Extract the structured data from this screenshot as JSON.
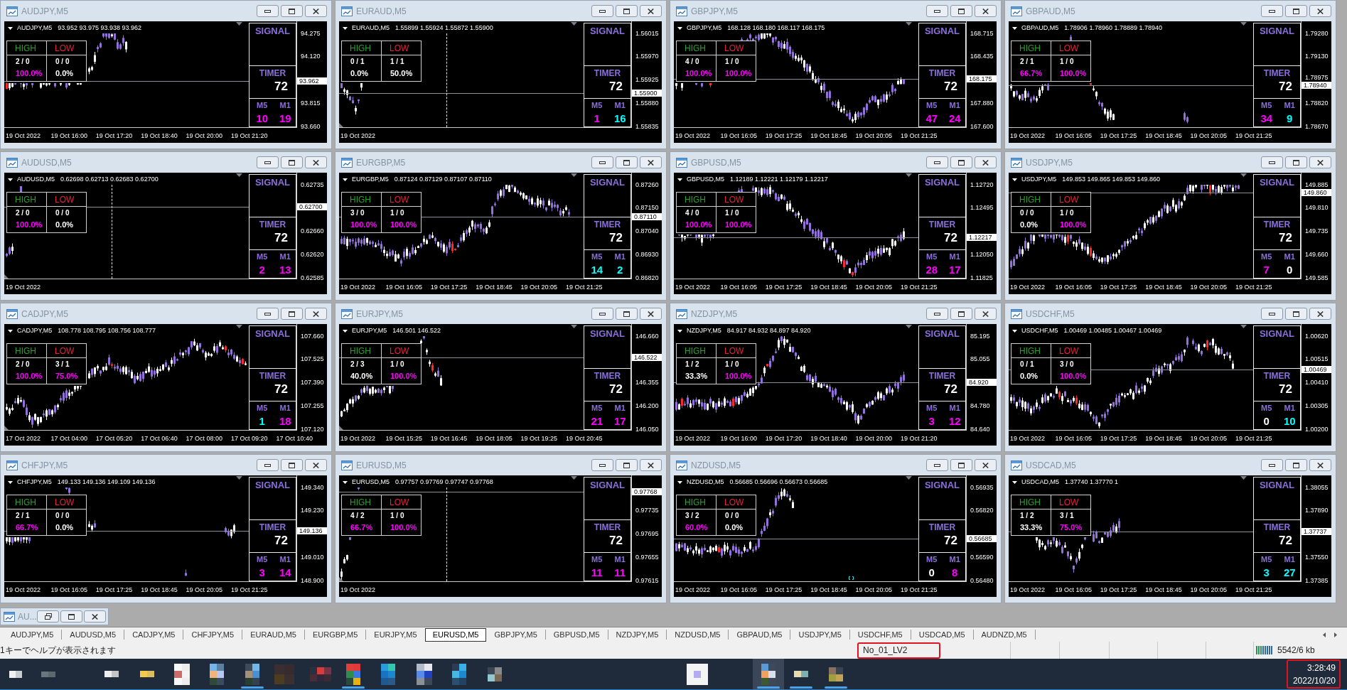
{
  "windows": [
    {
      "title": "AUDJPY,M5",
      "symbol": "AUDJPY,M5",
      "ohlc": "93.952 93.975 93.938 93.962",
      "price_labels": [
        "94.275",
        "94.120",
        "93.815",
        "93.660"
      ],
      "current_price": "93.962",
      "time_labels": [
        "19 Oct 2022",
        "19 Oct 16:00",
        "19 Oct 17:20",
        "19 Oct 18:40",
        "19 Oct 20:00",
        "19 Oct 21:20"
      ],
      "stats": [
        {
          "kind": "high",
          "label": "HIGH",
          "count": "2 / 0",
          "percent": "100.0%",
          "color": "#ff00ff"
        },
        {
          "kind": "low",
          "label": "LOW",
          "count": "0 / 0",
          "percent": "0.0%",
          "color": "#ffffff"
        }
      ],
      "signal": "SIGNAL",
      "timer": {
        "label": "TIMER",
        "value": "72"
      },
      "counters": [
        {
          "label": "M5",
          "value": "10",
          "color": "#ff00ff"
        },
        {
          "label": "M1",
          "value": "19",
          "color": "#ff00ff"
        }
      ]
    },
    {
      "title": "EURAUD,M5",
      "symbol": "EURAUD,M5",
      "ohlc": "1.55899 1.55924 1.55872 1.55900",
      "price_labels": [
        "1.56015",
        "1.55970",
        "1.55925",
        "1.55880",
        "1.55835"
      ],
      "current_price": "1.55900",
      "time_labels": [
        "19 Oct 2022"
      ],
      "separator_line": true,
      "stats": [
        {
          "kind": "high",
          "label": "HIGH",
          "count": "0 / 1",
          "percent": "0.0%",
          "color": "#ffffff"
        },
        {
          "kind": "low",
          "label": "LOW",
          "count": "1 / 1",
          "percent": "50.0%",
          "color": "#ffffff"
        }
      ],
      "signal": "SIGNAL",
      "timer": {
        "label": "TIMER",
        "value": "72"
      },
      "counters": [
        {
          "label": "M5",
          "value": "1",
          "color": "#ff00ff"
        },
        {
          "label": "M1",
          "value": "16",
          "color": "#00ffff"
        }
      ]
    },
    {
      "title": "GBPJPY,M5",
      "symbol": "GBPJPY,M5",
      "ohlc": "168.128 168.180 168.117 168.175",
      "price_labels": [
        "168.715",
        "168.435",
        "167.880",
        "167.600"
      ],
      "current_price": "168.175",
      "time_labels": [
        "19 Oct 2022",
        "19 Oct 16:05",
        "19 Oct 17:25",
        "19 Oct 18:45",
        "19 Oct 20:05",
        "19 Oct 21:25"
      ],
      "stats": [
        {
          "kind": "high",
          "label": "HIGH",
          "count": "4 / 0",
          "percent": "100.0%",
          "color": "#ff00ff"
        },
        {
          "kind": "low",
          "label": "LOW",
          "count": "1 / 0",
          "percent": "100.0%",
          "color": "#ff00ff"
        }
      ],
      "signal": "SIGNAL",
      "timer": {
        "label": "TIMER",
        "value": "72"
      },
      "counters": [
        {
          "label": "M5",
          "value": "47",
          "color": "#ff00ff"
        },
        {
          "label": "M1",
          "value": "24",
          "color": "#ff00ff"
        }
      ]
    },
    {
      "title": "GBPAUD,M5",
      "symbol": "GBPAUD,M5",
      "ohlc": "1.78906 1.78960 1.78889 1.78940",
      "price_labels": [
        "1.79280",
        "1.79130",
        "1.78975",
        "1.78820",
        "1.78670"
      ],
      "current_price": "1.78940",
      "time_labels": [
        "19 Oct 2022",
        "19 Oct 16:05",
        "19 Oct 17:25",
        "19 Oct 18:45",
        "19 Oct 20:05",
        "19 Oct 21:25"
      ],
      "stats": [
        {
          "kind": "high",
          "label": "HIGH",
          "count": "2 / 1",
          "percent": "66.7%",
          "color": "#ff00ff"
        },
        {
          "kind": "low",
          "label": "LOW",
          "count": "1 / 0",
          "percent": "100.0%",
          "color": "#ff00ff"
        }
      ],
      "signal": "SIGNAL",
      "timer": {
        "label": "TIMER",
        "value": "72"
      },
      "counters": [
        {
          "label": "M5",
          "value": "34",
          "color": "#ff00ff"
        },
        {
          "label": "M1",
          "value": "9",
          "color": "#00ffff"
        }
      ]
    },
    {
      "title": "AUDUSD,M5",
      "symbol": "AUDUSD,M5",
      "ohlc": "0.62698 0.62713 0.62683 0.62700",
      "price_labels": [
        "0.62735",
        "0.62660",
        "0.62620",
        "0.62585"
      ],
      "current_price": "0.62700",
      "time_labels": [
        "19 Oct 2022"
      ],
      "separator_line": true,
      "stats": [
        {
          "kind": "high",
          "label": "HIGH",
          "count": "2 / 0",
          "percent": "100.0%",
          "color": "#ff00ff"
        },
        {
          "kind": "low",
          "label": "LOW",
          "count": "0 / 0",
          "percent": "0.0%",
          "color": "#ffffff"
        }
      ],
      "signal": "SIGNAL",
      "timer": {
        "label": "TIMER",
        "value": "72"
      },
      "counters": [
        {
          "label": "M5",
          "value": "2",
          "color": "#ff00ff"
        },
        {
          "label": "M1",
          "value": "13",
          "color": "#ff00ff"
        }
      ]
    },
    {
      "title": "EURGBP,M5",
      "symbol": "EURGBP,M5",
      "ohlc": "0.87124 0.87129 0.87107 0.87110",
      "price_labels": [
        "0.87260",
        "0.87150",
        "0.87040",
        "0.86930",
        "0.86820"
      ],
      "current_price": "0.87110",
      "time_labels": [
        "19 Oct 2022",
        "19 Oct 16:05",
        "19 Oct 17:25",
        "19 Oct 18:45",
        "19 Oct 20:05",
        "19 Oct 21:25"
      ],
      "stats": [
        {
          "kind": "high",
          "label": "HIGH",
          "count": "3 / 0",
          "percent": "100.0%",
          "color": "#ff00ff"
        },
        {
          "kind": "low",
          "label": "LOW",
          "count": "1 / 0",
          "percent": "100.0%",
          "color": "#ff00ff"
        }
      ],
      "signal": "SIGNAL",
      "timer": {
        "label": "TIMER",
        "value": "72"
      },
      "counters": [
        {
          "label": "M5",
          "value": "14",
          "color": "#00ffff"
        },
        {
          "label": "M1",
          "value": "2",
          "color": "#00ffff"
        }
      ]
    },
    {
      "title": "GBPUSD,M5",
      "symbol": "GBPUSD,M5",
      "ohlc": "1.12189 1.12221 1.12179 1.12217",
      "price_labels": [
        "1.12720",
        "1.12495",
        "1.12050",
        "1.11825"
      ],
      "current_price": "1.12217",
      "time_labels": [
        "19 Oct 2022",
        "19 Oct 16:05",
        "19 Oct 17:25",
        "19 Oct 18:45",
        "19 Oct 20:05",
        "19 Oct 21:25"
      ],
      "stats": [
        {
          "kind": "high",
          "label": "HIGH",
          "count": "4 / 0",
          "percent": "100.0%",
          "color": "#ff00ff"
        },
        {
          "kind": "low",
          "label": "LOW",
          "count": "1 / 0",
          "percent": "100.0%",
          "color": "#ff00ff"
        }
      ],
      "signal": "SIGNAL",
      "timer": {
        "label": "TIMER",
        "value": "72"
      },
      "counters": [
        {
          "label": "M5",
          "value": "28",
          "color": "#ff00ff"
        },
        {
          "label": "M1",
          "value": "17",
          "color": "#ff00ff"
        }
      ]
    },
    {
      "title": "USDJPY,M5",
      "symbol": "USDJPY,M5",
      "ohlc": "149.853 149.865 149.853 149.860",
      "price_labels": [
        "149.885",
        "149.810",
        "149.735",
        "149.660",
        "149.585"
      ],
      "current_price": "149.860",
      "time_labels": [
        "19 Oct 2022",
        "19 Oct 16:05",
        "19 Oct 17:25",
        "19 Oct 18:45",
        "19 Oct 20:05",
        "19 Oct 21:25"
      ],
      "stats": [
        {
          "kind": "high",
          "label": "HIGH",
          "count": "0 / 0",
          "percent": "0.0%",
          "color": "#ffffff"
        },
        {
          "kind": "low",
          "label": "LOW",
          "count": "1 / 0",
          "percent": "100.0%",
          "color": "#ff00ff"
        }
      ],
      "signal": "SIGNAL",
      "timer": {
        "label": "TIMER",
        "value": "72"
      },
      "counters": [
        {
          "label": "M5",
          "value": "7",
          "color": "#ff00ff"
        },
        {
          "label": "M1",
          "value": "0",
          "color": "#ffffff"
        }
      ]
    },
    {
      "title": "CADJPY,M5",
      "symbol": "CADJPY,M5",
      "ohlc": "108.778 108.795 108.756 108.777",
      "price_labels": [
        "107.660",
        "107.525",
        "107.390",
        "107.255",
        "107.120"
      ],
      "time_labels": [
        "17 Oct 2022",
        "17 Oct 04:00",
        "17 Oct 05:20",
        "17 Oct 06:40",
        "17 Oct 08:00",
        "17 Oct 09:20",
        "17 Oct 10:40"
      ],
      "stats": [
        {
          "kind": "high",
          "label": "HIGH",
          "count": "2 / 0",
          "percent": "100.0%",
          "color": "#ff00ff"
        },
        {
          "kind": "low",
          "label": "LOW",
          "count": "3 / 1",
          "percent": "75.0%",
          "color": "#ff00ff"
        }
      ],
      "signal": "SIGNAL",
      "timer": {
        "label": "TIMER",
        "value": "72"
      },
      "counters": [
        {
          "label": "M5",
          "value": "1",
          "color": "#00ffff"
        },
        {
          "label": "M1",
          "value": "18",
          "color": "#ff00ff"
        }
      ]
    },
    {
      "title": "EURJPY,M5",
      "symbol": "EURJPY,M5",
      "ohlc": "146.501 146.522",
      "price_labels": [
        "146.660",
        "146.355",
        "146.200",
        "146.050"
      ],
      "current_price": "146.522",
      "time_labels": [
        "19 Oct 2022",
        "19 Oct 15:25",
        "19 Oct 16:45",
        "19 Oct 18:05",
        "19 Oct 19:25",
        "19 Oct 20:45"
      ],
      "stats": [
        {
          "kind": "high",
          "label": "HIGH",
          "count": "2 / 3",
          "percent": "40.0%",
          "color": "#ffffff"
        },
        {
          "kind": "low",
          "label": "LOW",
          "count": "1 / 0",
          "percent": "100.0%",
          "color": "#ff00ff"
        }
      ],
      "signal": "SIGNAL",
      "timer": {
        "label": "TIMER",
        "value": "72"
      },
      "counters": [
        {
          "label": "M5",
          "value": "21",
          "color": "#ff00ff"
        },
        {
          "label": "M1",
          "value": "17",
          "color": "#ff00ff"
        }
      ]
    },
    {
      "title": "NZDJPY,M5",
      "symbol": "NZDJPY,M5",
      "ohlc": "84.917 84.932 84.897 84.920",
      "price_labels": [
        "85.195",
        "85.055",
        "84.780",
        "84.640"
      ],
      "current_price": "84.920",
      "time_labels": [
        "19 Oct 2022",
        "19 Oct 16:00",
        "19 Oct 17:20",
        "19 Oct 18:40",
        "19 Oct 20:00",
        "19 Oct 21:20"
      ],
      "stats": [
        {
          "kind": "high",
          "label": "HIGH",
          "count": "1 / 2",
          "percent": "33.3%",
          "color": "#ffffff"
        },
        {
          "kind": "low",
          "label": "LOW",
          "count": "1 / 0",
          "percent": "100.0%",
          "color": "#ff00ff"
        }
      ],
      "signal": "SIGNAL",
      "timer": {
        "label": "TIMER",
        "value": "72"
      },
      "counters": [
        {
          "label": "M5",
          "value": "3",
          "color": "#ff00ff"
        },
        {
          "label": "M1",
          "value": "12",
          "color": "#ff00ff"
        }
      ]
    },
    {
      "title": "USDCHF,M5",
      "symbol": "USDCHF,M5",
      "ohlc": "1.00469 1.00485 1.00467 1.00469",
      "price_labels": [
        "1.00620",
        "1.00515",
        "1.00410",
        "1.00305",
        "1.00200"
      ],
      "current_price": "1.00469",
      "time_labels": [
        "19 Oct 2022",
        "19 Oct 16:05",
        "19 Oct 17:25",
        "19 Oct 18:45",
        "19 Oct 20:05",
        "19 Oct 21:25"
      ],
      "stats": [
        {
          "kind": "high",
          "label": "HIGH",
          "count": "0 / 1",
          "percent": "0.0%",
          "color": "#ffffff"
        },
        {
          "kind": "low",
          "label": "LOW",
          "count": "3 / 0",
          "percent": "100.0%",
          "color": "#ff00ff"
        }
      ],
      "signal": "SIGNAL",
      "timer": {
        "label": "TIMER",
        "value": "72"
      },
      "counters": [
        {
          "label": "M5",
          "value": "0",
          "color": "#ffffff"
        },
        {
          "label": "M1",
          "value": "10",
          "color": "#00ffff"
        }
      ]
    },
    {
      "title": "CHFJPY,M5",
      "symbol": "CHFJPY,M5",
      "ohlc": "149.133 149.136 149.109 149.136",
      "price_labels": [
        "149.340",
        "149.230",
        "149.010",
        "148.900"
      ],
      "current_price": "149.136",
      "time_labels": [
        "19 Oct 2022",
        "19 Oct 16:05",
        "19 Oct 17:25",
        "19 Oct 18:45",
        "19 Oct 20:05",
        "19 Oct 21:25"
      ],
      "stats": [
        {
          "kind": "high",
          "label": "HIGH",
          "count": "2 / 1",
          "percent": "66.7%",
          "color": "#ff00ff"
        },
        {
          "kind": "low",
          "label": "LOW",
          "count": "0 / 0",
          "percent": "0.0%",
          "color": "#ffffff"
        }
      ],
      "signal": "SIGNAL",
      "timer": {
        "label": "TIMER",
        "value": "72"
      },
      "counters": [
        {
          "label": "M5",
          "value": "3",
          "color": "#ff00ff"
        },
        {
          "label": "M1",
          "value": "14",
          "color": "#ff00ff"
        }
      ]
    },
    {
      "title": "EURUSD,M5",
      "symbol": "EURUSD,M5",
      "ohlc": "0.97757 0.97769 0.97747 0.97768",
      "price_labels": [
        "0.97735",
        "0.97695",
        "0.97655",
        "0.97615"
      ],
      "current_price": "0.97768",
      "time_labels": [
        "19 Oct 2022"
      ],
      "separator_line": true,
      "stats": [
        {
          "kind": "high",
          "label": "HIGH",
          "count": "4 / 2",
          "percent": "66.7%",
          "color": "#ff00ff"
        },
        {
          "kind": "low",
          "label": "LOW",
          "count": "1 / 0",
          "percent": "100.0%",
          "color": "#ff00ff"
        }
      ],
      "signal": "SIGNAL",
      "timer": {
        "label": "TIMER",
        "value": "72"
      },
      "counters": [
        {
          "label": "M5",
          "value": "11",
          "color": "#ff00ff"
        },
        {
          "label": "M1",
          "value": "11",
          "color": "#ff00ff"
        }
      ]
    },
    {
      "title": "NZDUSD,M5",
      "symbol": "NZDUSD,M5",
      "ohlc": "0.56685 0.56696 0.56673 0.56685",
      "price_labels": [
        "0.56935",
        "0.56820",
        "0.56590",
        "0.56480"
      ],
      "current_price": "0.56685",
      "time_labels": [
        "19 Oct 2022",
        "19 Oct 16:05",
        "19 Oct 17:25",
        "19 Oct 18:45",
        "19 Oct 20:05",
        "19 Oct 21:25"
      ],
      "stats": [
        {
          "kind": "high",
          "label": "HIGH",
          "count": "3 / 2",
          "percent": "60.0%",
          "color": "#ff00ff"
        },
        {
          "kind": "low",
          "label": "LOW",
          "count": "0 / 0",
          "percent": "0.0%",
          "color": "#ffffff"
        }
      ],
      "signal": "SIGNAL",
      "timer": {
        "label": "TIMER",
        "value": "72"
      },
      "counters": [
        {
          "label": "M5",
          "value": "0",
          "color": "#ffffff"
        },
        {
          "label": "M1",
          "value": "8",
          "color": "#ff00ff"
        }
      ]
    },
    {
      "title": "USDCAD,M5",
      "symbol": "USDCAD,M5",
      "ohlc": "1.37740 1.37770 1",
      "price_labels": [
        "1.38055",
        "1.37890",
        "1.37550",
        "1.37385"
      ],
      "current_price": "1.37737",
      "time_labels": [
        "19 Oct 2022",
        "19 Oct 16:05",
        "19 Oct 17:25",
        "19 Oct 18:45",
        "19 Oct 20:05",
        "19 Oct 21:25"
      ],
      "stats": [
        {
          "kind": "high",
          "label": "HIGH",
          "count": "1 / 2",
          "percent": "33.3%",
          "color": "#ffffff"
        },
        {
          "kind": "low",
          "label": "LOW",
          "count": "3 / 1",
          "percent": "75.0%",
          "color": "#ff00ff"
        }
      ],
      "signal": "SIGNAL",
      "timer": {
        "label": "TIMER",
        "value": "72"
      },
      "counters": [
        {
          "label": "M5",
          "value": "3",
          "color": "#00ffff"
        },
        {
          "label": "M1",
          "value": "27",
          "color": "#00ffff"
        }
      ]
    }
  ],
  "minimized_window": {
    "title": "AU..."
  },
  "tabs": [
    {
      "label": "AUDJPY,M5",
      "selected": false
    },
    {
      "label": "AUDUSD,M5",
      "selected": false
    },
    {
      "label": "CADJPY,M5",
      "selected": false
    },
    {
      "label": "CHFJPY,M5",
      "selected": false
    },
    {
      "label": "EURAUD,M5",
      "selected": false
    },
    {
      "label": "EURGBP,M5",
      "selected": false
    },
    {
      "label": "EURJPY,M5",
      "selected": false
    },
    {
      "label": "EURUSD,M5",
      "selected": true
    },
    {
      "label": "GBPJPY,M5",
      "selected": false
    },
    {
      "label": "GBPUSD,M5",
      "selected": false
    },
    {
      "label": "NZDJPY,M5",
      "selected": false
    },
    {
      "label": "NZDUSD,M5",
      "selected": false
    },
    {
      "label": "GBPAUD,M5",
      "selected": false
    },
    {
      "label": "USDJPY,M5",
      "selected": false
    },
    {
      "label": "USDCHF,M5",
      "selected": false
    },
    {
      "label": "USDCAD,M5",
      "selected": false
    },
    {
      "label": "AUDNZD,M5",
      "selected": false
    }
  ],
  "status_bar": {
    "help": "1キーでヘルプが表示されます",
    "profile": {
      "text": "No_01_LV2",
      "highlighted": true
    },
    "traffic": "5542/6 kb"
  },
  "taskbar": {
    "items": [
      {
        "running": false,
        "active": false
      },
      {
        "running": false,
        "active": false
      },
      {
        "running": false,
        "active": false
      },
      {
        "running": false,
        "active": false
      },
      {
        "running": false,
        "active": false
      },
      {
        "running": false,
        "active": false
      },
      {
        "running": true,
        "active": false
      },
      {
        "running": false,
        "active": false
      },
      {
        "running": false,
        "active": false
      },
      {
        "running": true,
        "active": false
      },
      {
        "running": false,
        "active": false
      },
      {
        "running": false,
        "active": false
      },
      {
        "running": false,
        "active": false
      },
      {
        "running": false,
        "active": false
      },
      {
        "running": false,
        "active": false
      },
      {
        "running": true,
        "active": true
      },
      {
        "running": true,
        "active": false
      },
      {
        "running": true,
        "active": false
      }
    ],
    "clock": {
      "time": "3:28:49",
      "date": "2022/10/20",
      "highlighted": true
    }
  }
}
